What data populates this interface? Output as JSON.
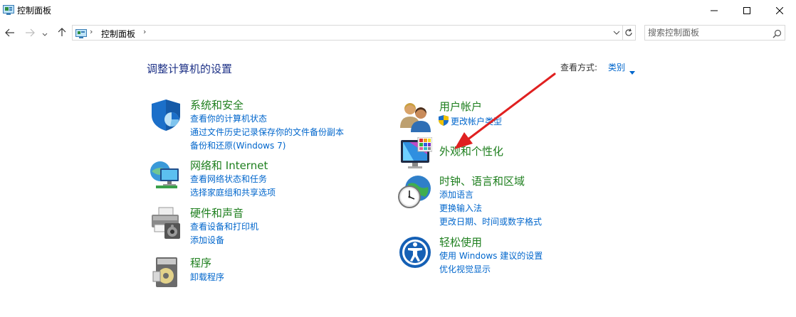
{
  "window": {
    "title": "控制面板"
  },
  "address": {
    "breadcrumb": "控制面板"
  },
  "search": {
    "placeholder": "搜索控制面板"
  },
  "main": {
    "heading": "调整计算机的设置",
    "view_by_label": "查看方式:",
    "view_by_value": "类别"
  },
  "categories": [
    {
      "title": "系统和安全",
      "icon": "shield-icon",
      "links": [
        "查看你的计算机状态",
        "通过文件历史记录保存你的文件备份副本",
        "备份和还原(Windows 7)"
      ]
    },
    {
      "title": "网络和 Internet",
      "icon": "network-globe-icon",
      "links": [
        "查看网络状态和任务",
        "选择家庭组和共享选项"
      ]
    },
    {
      "title": "硬件和声音",
      "icon": "printer-speaker-icon",
      "links": [
        "查看设备和打印机",
        "添加设备"
      ]
    },
    {
      "title": "程序",
      "icon": "programs-disc-icon",
      "links": [
        "卸载程序"
      ]
    },
    {
      "title": "用户帐户",
      "icon": "users-icon",
      "links": [
        "更改帐户类型"
      ]
    },
    {
      "title": "外观和个性化",
      "icon": "monitor-palette-icon",
      "links": []
    },
    {
      "title": "时钟、语言和区域",
      "icon": "clock-globe-icon",
      "links": [
        "添加语言",
        "更换输入法",
        "更改日期、时间或数字格式"
      ]
    },
    {
      "title": "轻松使用",
      "icon": "ease-of-access-icon",
      "links": [
        "使用 Windows 建议的设置",
        "优化视觉显示"
      ]
    }
  ],
  "colors": {
    "heading": "#1e3287",
    "category_title": "#1e7f1e",
    "link": "#0066cc",
    "annotation_arrow": "#e02020"
  }
}
